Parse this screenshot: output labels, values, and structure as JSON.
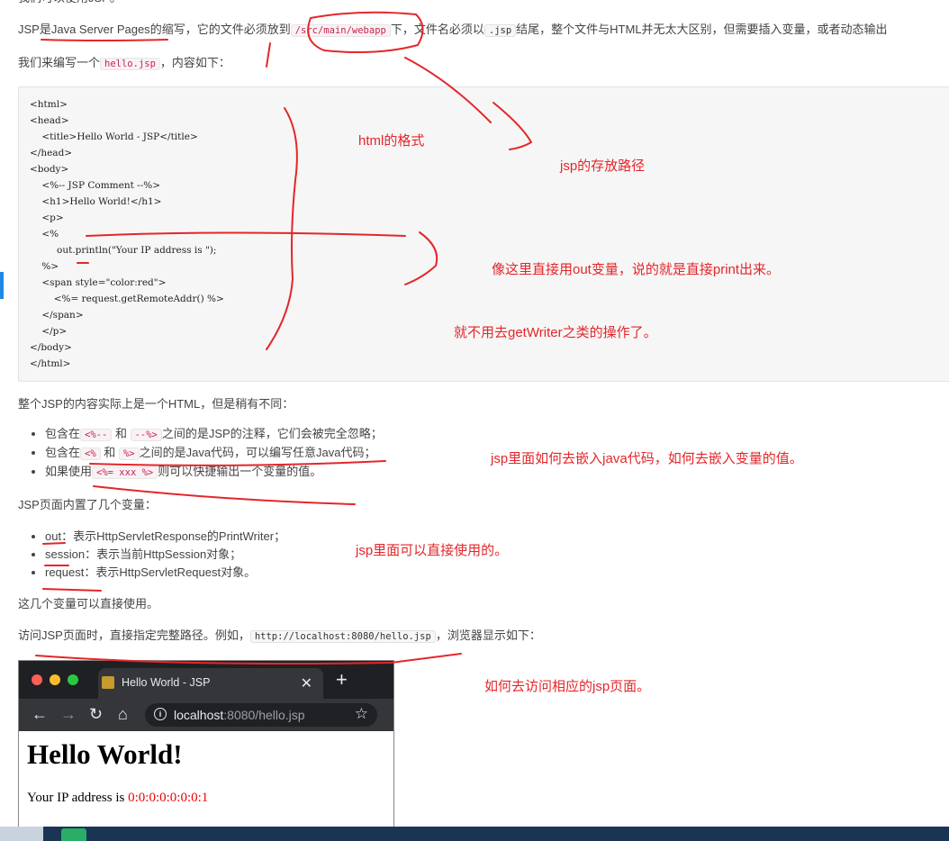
{
  "article": {
    "top_partial": "我们可以使用JSP。",
    "p1": {
      "a": "JSP是",
      "b": "Java Server Pages",
      "c": "的缩写，它的文件必须放到",
      "code1": "/src/main/webapp",
      "d": "下，文件名必须以",
      "code2": ".jsp",
      "e": "结尾，整个文件与HTML并无太大区别，但需要插入变量，或者动态输出"
    },
    "p2": {
      "a": "我们来编写一个",
      "code": "hello.jsp",
      "b": "，内容如下："
    },
    "code_lines": [
      "<html>",
      "<head>",
      "    <title>Hello World - JSP</title>",
      "</head>",
      "<body>",
      "    <%-- JSP Comment --%>",
      "    <h1>Hello World!</h1>",
      "    <p>",
      "    <%",
      "         out.println(\"Your IP address is \");",
      "    %>",
      "    <span style=\"color:red\">",
      "        <%= request.getRemoteAddr() %>",
      "    </span>",
      "    </p>",
      "</body>",
      "</html>"
    ],
    "p3": "整个JSP的内容实际上是一个HTML，但是稍有不同：",
    "list1": [
      {
        "a": "包含在",
        "c1": "<%--",
        "m": "和",
        "c2": "--%>",
        "b": "之间的是JSP的注释，它们会被完全忽略；"
      },
      {
        "a": "包含在",
        "c1": "<%",
        "m": "和",
        "c2": "%>",
        "b": "之间的是Java代码，可以编写任意Java代码；"
      },
      {
        "a": "如果使用",
        "c1": "<%= xxx %>",
        "b": "则可以快捷输出一个变量的值。"
      }
    ],
    "p4": "JSP页面内置了几个变量：",
    "list2": [
      {
        "name": "out",
        "desc": "：表示HttpServletResponse的PrintWriter；"
      },
      {
        "name": "session",
        "desc": "：表示当前HttpSession对象；"
      },
      {
        "name": "request",
        "desc": "：表示HttpServletRequest对象。"
      }
    ],
    "p5": "这几个变量可以直接使用。",
    "p6": {
      "a": "访问JSP页面时，直接指定完整路径。例如，",
      "code": "http://localhost:8080/hello.jsp",
      "b": "，浏览器显示如下："
    }
  },
  "annotations": {
    "html_format": "html的格式",
    "jsp_path": "jsp的存放路径",
    "out_note": "像这里直接用out变量，说的就是直接print出来。",
    "writer_note": "就不用去getWriter之类的操作了。",
    "embed_note": "jsp里面如何去嵌入java代码，如何去嵌入变量的值。",
    "vars_note": "jsp里面可以直接使用的。",
    "access_note": "如何去访问相应的jsp页面。"
  },
  "browser": {
    "tab_title": "Hello World - JSP",
    "url_host": "localhost",
    "url_rest": ":8080/hello.jsp",
    "heading": "Hello World!",
    "ip_label": "Your IP address is ",
    "ip_value": "0:0:0:0:0:0:0:1"
  },
  "colors": {
    "annotation_red": "#e4262a",
    "accent_blue": "#1e88e5"
  }
}
